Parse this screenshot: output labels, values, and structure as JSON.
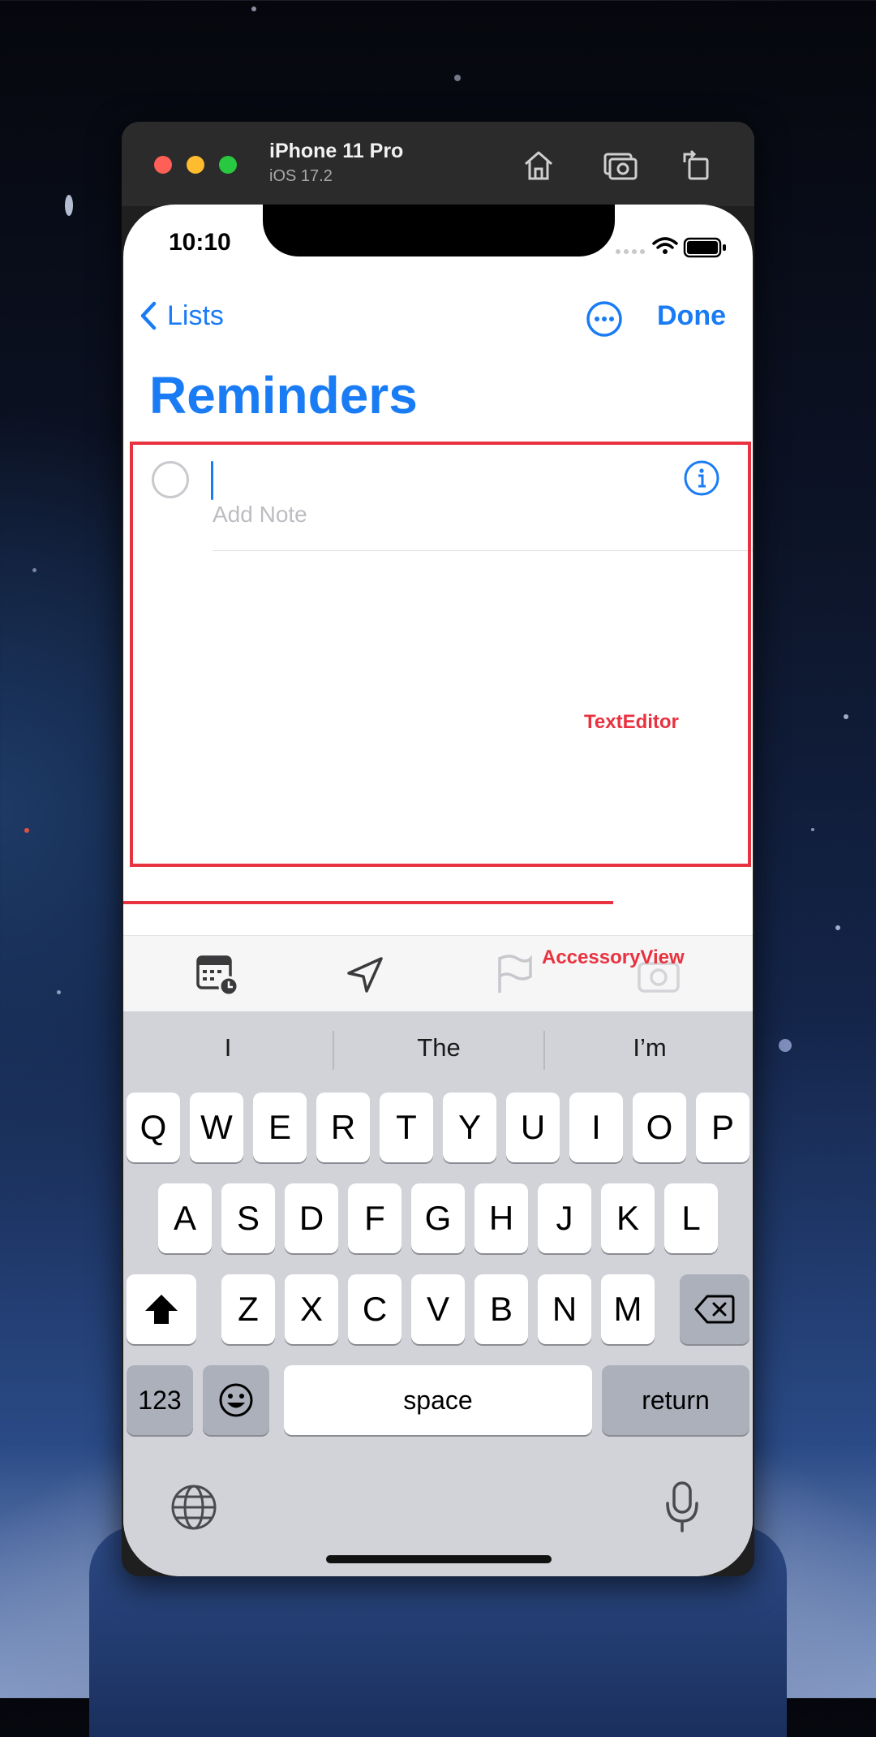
{
  "simulator": {
    "device_name": "iPhone 11 Pro",
    "os_version": "iOS 17.2",
    "buttons": [
      "home-icon",
      "screenshot-icon",
      "rotate-icon"
    ]
  },
  "status_bar": {
    "time": "10:10"
  },
  "nav": {
    "back_label": "Lists",
    "done_label": "Done"
  },
  "page": {
    "title": "Reminders"
  },
  "reminder": {
    "note_placeholder": "Add Note"
  },
  "annotations": {
    "text_editor": "TextEditor",
    "accessory_view": "AccessoryView"
  },
  "accessory_bar": {
    "icons": [
      "calendar-clock-icon",
      "location-arrow-icon",
      "flag-icon",
      "camera-icon"
    ]
  },
  "keyboard": {
    "suggestions": [
      "I",
      "The",
      "I’m"
    ],
    "row1": [
      "Q",
      "W",
      "E",
      "R",
      "T",
      "Y",
      "U",
      "I",
      "O",
      "P"
    ],
    "row2": [
      "A",
      "S",
      "D",
      "F",
      "G",
      "H",
      "J",
      "K",
      "L"
    ],
    "row3": [
      "Z",
      "X",
      "C",
      "V",
      "B",
      "N",
      "M"
    ],
    "numbers_label": "123",
    "space_label": "space",
    "return_label": "return"
  },
  "colors": {
    "accent": "#1a7cf5",
    "annotation": "#e8323f"
  }
}
